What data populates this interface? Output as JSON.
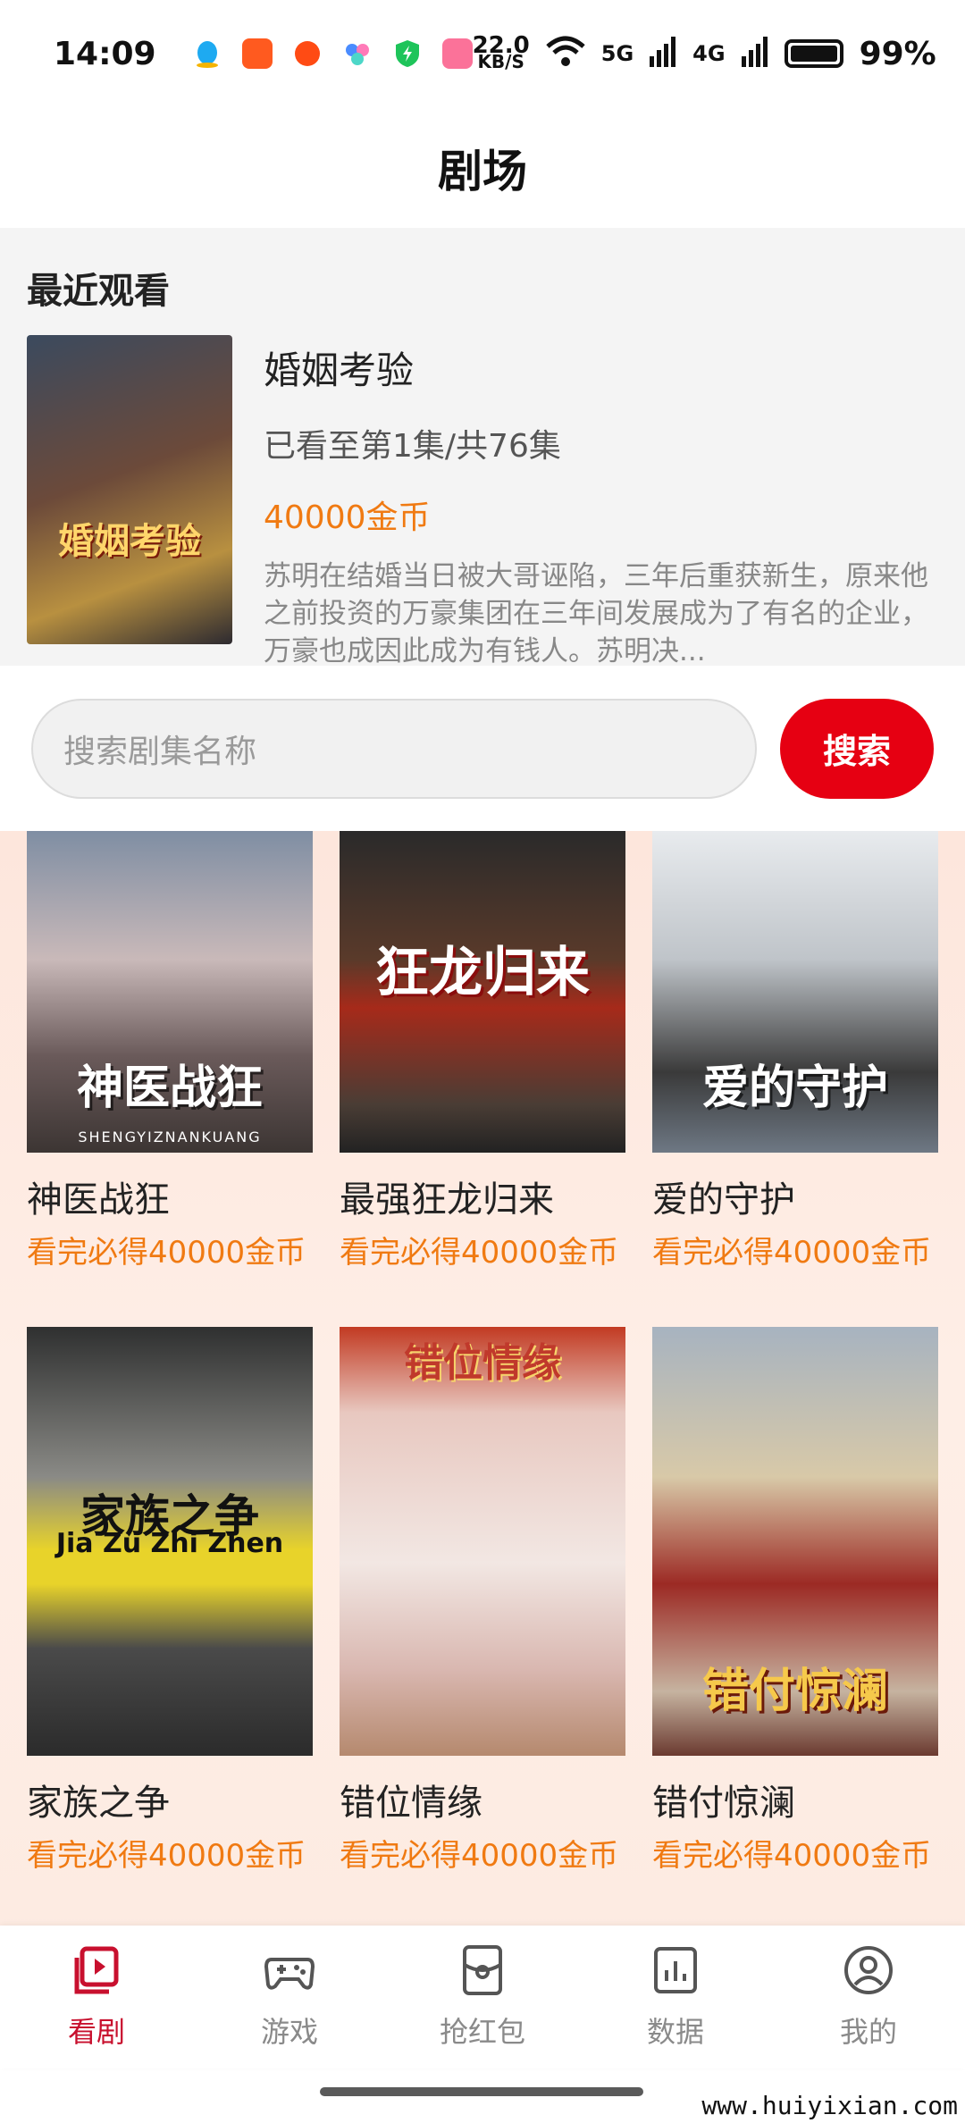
{
  "status_bar": {
    "time": "14:09",
    "net_speed_value": "22.0",
    "net_speed_unit": "KB/S",
    "sig_5g": "5G",
    "sig_4g": "4G",
    "battery": "99%"
  },
  "header": {
    "title": "剧场"
  },
  "recent": {
    "heading": "最近观看",
    "cover_text": "婚姻考验",
    "title": "婚姻考验",
    "progress": "已看至第1集/共76集",
    "coins": "40000金币",
    "description": "苏明在结婚当日被大哥诬陷，三年后重获新生，原来他之前投资的万豪集团在三年间发展成为了有名的企业，万豪也成因此成为有钱人。苏明决..."
  },
  "search": {
    "placeholder": "搜索剧集名称",
    "button_label": "搜索"
  },
  "dramas": [
    {
      "name": "神医战狂",
      "reward": "看完必得40000金币",
      "poster_text": "神医战狂",
      "poster_sub": "SHENGYIZNANKUANG"
    },
    {
      "name": "最强狂龙归来",
      "reward": "看完必得40000金币",
      "poster_text": "狂龙归来",
      "poster_sub": ""
    },
    {
      "name": "爱的守护",
      "reward": "看完必得40000金币",
      "poster_text": "爱的守护",
      "poster_sub": ""
    },
    {
      "name": "家族之争",
      "reward": "看完必得40000金币",
      "poster_text": "家族之争",
      "poster_sub": "Jia Zu Zhi Zhen"
    },
    {
      "name": "错位情缘",
      "reward": "看完必得40000金币",
      "poster_text": "错位情缘",
      "poster_sub": ""
    },
    {
      "name": "错付惊澜",
      "reward": "看完必得40000金币",
      "poster_text": "错付惊澜",
      "poster_sub": ""
    }
  ],
  "tabs": [
    {
      "label": "看剧",
      "icon": "play-video-icon",
      "active": true
    },
    {
      "label": "游戏",
      "icon": "gamepad-icon",
      "active": false
    },
    {
      "label": "抢红包",
      "icon": "red-packet-icon",
      "active": false
    },
    {
      "label": "数据",
      "icon": "bar-chart-icon",
      "active": false
    },
    {
      "label": "我的",
      "icon": "profile-icon",
      "active": false
    }
  ],
  "watermark": "www.huiyixian.com",
  "colors": {
    "accent": "#e60012",
    "coin": "#f07a12",
    "active_tab": "#c8102e"
  }
}
